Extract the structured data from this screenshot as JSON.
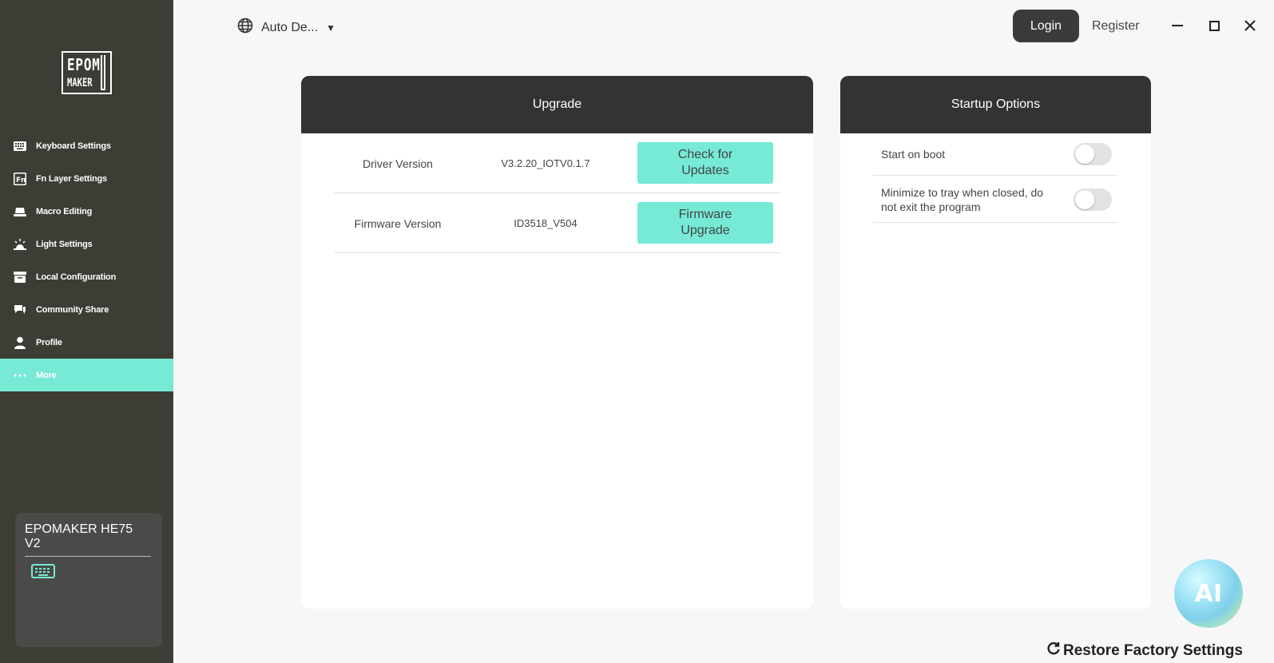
{
  "brand": {
    "logo_line1": "EPOM",
    "logo_line2": "MAKER"
  },
  "sidebar": {
    "items": [
      {
        "label": "Keyboard Settings",
        "icon": "keyboard-icon",
        "active": false
      },
      {
        "label": "Fn Layer Settings",
        "icon": "fn-icon",
        "active": false
      },
      {
        "label": "Macro Editing",
        "icon": "macro-icon",
        "active": false
      },
      {
        "label": "Light Settings",
        "icon": "light-icon",
        "active": false
      },
      {
        "label": "Local Configuration",
        "icon": "archive-icon",
        "active": false
      },
      {
        "label": "Community Share",
        "icon": "chat-icon",
        "active": false
      },
      {
        "label": "Profile",
        "icon": "user-icon",
        "active": false
      },
      {
        "label": "More",
        "icon": "more-dots-icon",
        "active": true
      }
    ],
    "device": {
      "name": "EPOMAKER HE75 V2",
      "icon": "keyboard-icon",
      "icon_color": "#76ead5"
    }
  },
  "topbar": {
    "language": "Auto De...",
    "login": "Login",
    "register": "Register"
  },
  "upgrade": {
    "title": "Upgrade",
    "rows": [
      {
        "label": "Driver Version",
        "value": "V3.2.20_IOTV0.1.7",
        "button": "Check for Updates"
      },
      {
        "label": "Firmware Version",
        "value": "ID3518_V504",
        "button": "Firmware Upgrade"
      }
    ]
  },
  "startup": {
    "title": "Startup Options",
    "options": [
      {
        "label": "Start on boot",
        "enabled": false
      },
      {
        "label": "Minimize to tray when closed, do not exit the program",
        "enabled": false
      }
    ]
  },
  "assistant": {
    "label": "AI"
  },
  "footer": {
    "restore": "Restore Factory Settings"
  },
  "colors": {
    "sidebar": "#3d3c35",
    "accent": "#76ead5",
    "header": "#333333",
    "background": "#f7f7f7"
  }
}
